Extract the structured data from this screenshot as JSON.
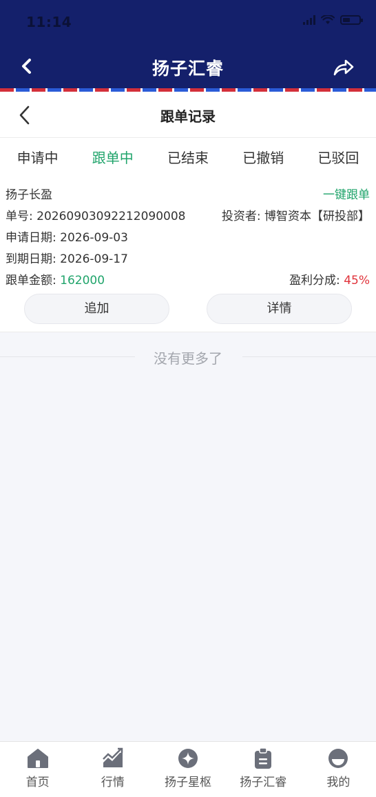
{
  "status_bar": {
    "time": "11:14"
  },
  "nav": {
    "title": "扬子汇睿"
  },
  "subpage": {
    "title": "跟单记录"
  },
  "tabs": [
    {
      "label": "申请中",
      "active": false
    },
    {
      "label": "跟单中",
      "active": true
    },
    {
      "label": "已结束",
      "active": false
    },
    {
      "label": "已撤销",
      "active": false
    },
    {
      "label": "已驳回",
      "active": false
    }
  ],
  "record": {
    "product_name": "扬子长盈",
    "one_click_label": "一键跟单",
    "order_no_label": "单号: ",
    "order_no": "20260903092212090008",
    "investor_label": "投资者: ",
    "investor": "博智资本【研投部】",
    "apply_date_label": "申请日期: ",
    "apply_date": "2026-09-03",
    "expiry_date_label": "到期日期: ",
    "expiry_date": "2026-09-17",
    "amount_label": "跟单金额: ",
    "amount": "162000",
    "profit_share_label": "盈利分成: ",
    "profit_share": "45%",
    "add_button": "追加",
    "detail_button": "详情"
  },
  "list_end_text": "没有更多了",
  "bottom_tabs": [
    {
      "label": "首页",
      "icon": "home-icon"
    },
    {
      "label": "行情",
      "icon": "chart-icon"
    },
    {
      "label": "扬子星枢",
      "icon": "star-icon"
    },
    {
      "label": "扬子汇睿",
      "icon": "clipboard-icon"
    },
    {
      "label": "我的",
      "icon": "profile-icon"
    }
  ],
  "colors": {
    "header_bg": "#14206b",
    "accent_green": "#20a46b",
    "accent_red": "#e0333b",
    "tab_icon": "#6b6f7a"
  }
}
